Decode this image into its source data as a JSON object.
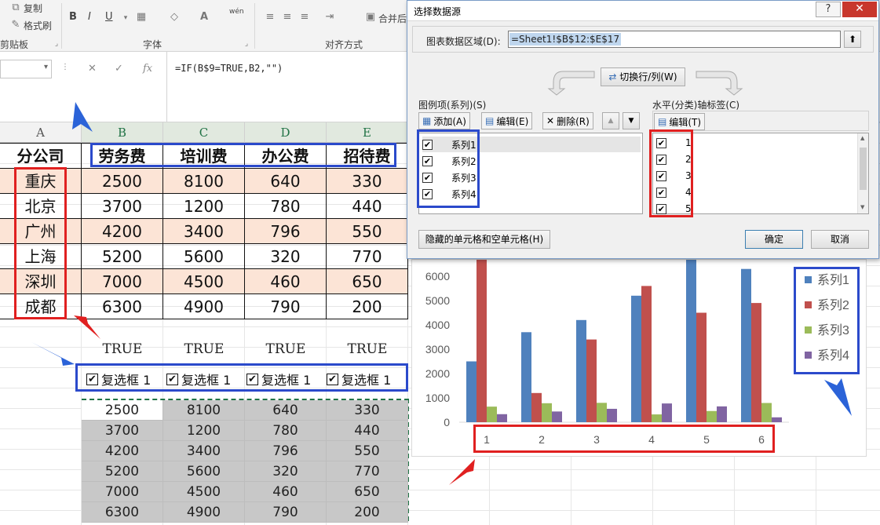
{
  "ribbon": {
    "copy_label": "复制",
    "format_painter_label": "格式刷",
    "clipboard_group": "剪贴板",
    "font_group": "字体",
    "align_group": "对齐方式",
    "merge_label": "合并后",
    "bold": "B",
    "italic": "I",
    "underline": "U",
    "wen": "wén"
  },
  "formula_bar": {
    "fx": "fx",
    "formula": "=IF(B$9=TRUE,B2,\"\")"
  },
  "columns": [
    "A",
    "B",
    "C",
    "D",
    "E"
  ],
  "table": {
    "headers": [
      "分公司",
      "劳务费",
      "培训费",
      "办公费",
      "招待费"
    ],
    "rows": [
      [
        "重庆",
        "2500",
        "8100",
        "640",
        "330"
      ],
      [
        "北京",
        "3700",
        "1200",
        "780",
        "440"
      ],
      [
        "广州",
        "4200",
        "3400",
        "796",
        "550"
      ],
      [
        "上海",
        "5200",
        "5600",
        "320",
        "770"
      ],
      [
        "深圳",
        "7000",
        "4500",
        "460",
        "650"
      ],
      [
        "成都",
        "6300",
        "4900",
        "790",
        "200"
      ]
    ]
  },
  "true_row": [
    "TRUE",
    "TRUE",
    "TRUE",
    "TRUE"
  ],
  "checkboxes": [
    "复选框 1",
    "复选框 1",
    "复选框 1",
    "复选框 1"
  ],
  "checkmark": "✔",
  "result_table": [
    [
      "2500",
      "8100",
      "640",
      "330"
    ],
    [
      "3700",
      "1200",
      "780",
      "440"
    ],
    [
      "4200",
      "3400",
      "796",
      "550"
    ],
    [
      "5200",
      "5600",
      "320",
      "770"
    ],
    [
      "7000",
      "4500",
      "460",
      "650"
    ],
    [
      "6300",
      "4900",
      "790",
      "200"
    ]
  ],
  "dialog": {
    "title": "选择数据源",
    "help": "?",
    "close": "✕",
    "range_label": "图表数据区域(D):",
    "range_value": "=Sheet1!$B$12:$E$17",
    "switch_label": "切换行/列(W)",
    "legend_label": "图例项(系列)(S)",
    "add_label": "添加(A)",
    "edit_label": "编辑(E)",
    "delete_label": "删除(R)",
    "axis_label": "水平(分类)轴标签(C)",
    "axis_edit_label": "编辑(T)",
    "series": [
      "系列1",
      "系列2",
      "系列3",
      "系列4"
    ],
    "categories": [
      "1",
      "2",
      "3",
      "4",
      "5"
    ],
    "hidden_cells_label": "隐藏的单元格和空单元格(H)",
    "ok_label": "确定",
    "cancel_label": "取消"
  },
  "chart_data": {
    "type": "bar",
    "categories": [
      "1",
      "2",
      "3",
      "4",
      "5",
      "6"
    ],
    "series": [
      {
        "name": "系列1",
        "color": "#4f81bd",
        "values": [
          2500,
          3700,
          4200,
          5200,
          7000,
          6300
        ]
      },
      {
        "name": "系列2",
        "color": "#c0504d",
        "values": [
          8100,
          1200,
          3400,
          5600,
          4500,
          4900
        ]
      },
      {
        "name": "系列3",
        "color": "#9bbb59",
        "values": [
          640,
          780,
          796,
          320,
          460,
          790
        ]
      },
      {
        "name": "系列4",
        "color": "#8064a2",
        "values": [
          330,
          440,
          550,
          770,
          650,
          200
        ]
      }
    ],
    "yticks": [
      "0",
      "1000",
      "2000",
      "3000",
      "4000",
      "5000",
      "6000"
    ],
    "ylim": [
      0,
      7000
    ],
    "legend": "right",
    "grid": false
  }
}
